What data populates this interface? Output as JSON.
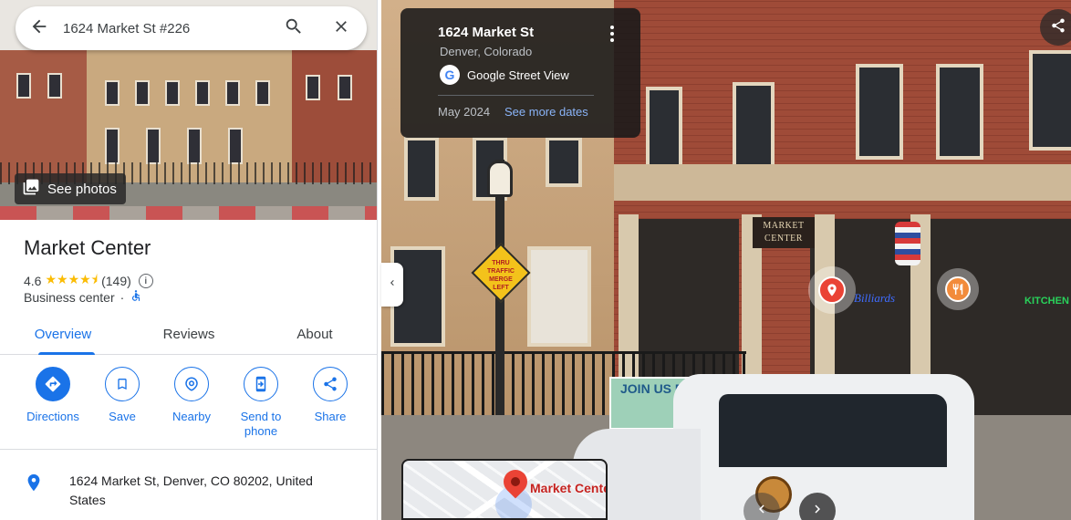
{
  "search": {
    "value": "1624 Market St #226",
    "back_icon": "arrow-left-icon",
    "search_icon": "search-icon",
    "close_icon": "close-icon"
  },
  "hero": {
    "see_photos_label": "See photos",
    "photos_icon": "photo-library-icon"
  },
  "place": {
    "name": "Market Center",
    "rating": "4.6",
    "stars": "★★★★⯨",
    "review_count": "(149)",
    "category": "Business center",
    "category_separator": "·",
    "accessibility_icon": "wheelchair-icon"
  },
  "tabs": [
    {
      "label": "Overview",
      "active": true
    },
    {
      "label": "Reviews",
      "active": false
    },
    {
      "label": "About",
      "active": false
    }
  ],
  "actions": [
    {
      "label": "Directions",
      "icon": "directions-icon"
    },
    {
      "label": "Save",
      "icon": "bookmark-icon"
    },
    {
      "label": "Nearby",
      "icon": "nearby-icon"
    },
    {
      "label": "Send to phone",
      "icon": "send-to-phone-icon"
    },
    {
      "label": "Share",
      "icon": "share-icon"
    }
  ],
  "address": {
    "text": "1624 Market St, Denver, CO 80202, United States",
    "icon": "location-pin-icon"
  },
  "street_view": {
    "card_title": "1624 Market St",
    "card_subtitle": "Denver, Colorado",
    "source_label": "Google Street View",
    "google_logo_letter": "G",
    "date": "May 2024",
    "see_more_dates": "See more dates",
    "scene_sign_market": "MARKET\nCENTER",
    "scene_sign_billiards": "Billiards",
    "scene_sign_kitchen": "KITCHEN",
    "scene_sign_traffic": "THRU TRAFFIC MERGE LEFT",
    "scene_banner": "JOIN US FOR HAPPY HOU"
  },
  "minimap": {
    "label": "Market Cente"
  },
  "colors": {
    "accent": "#1a73e8",
    "star": "#fbbc04",
    "pin": "#ea4335",
    "food": "#f28b3b"
  }
}
